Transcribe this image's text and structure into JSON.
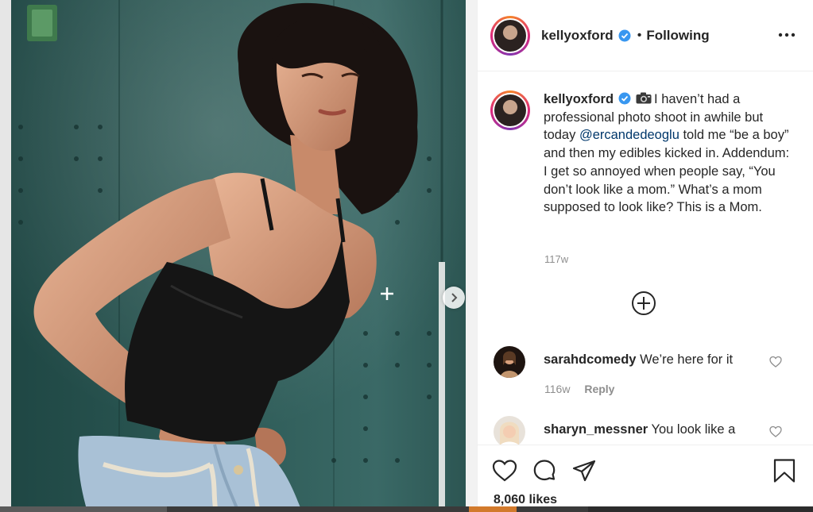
{
  "post": {
    "username": "kellyoxford",
    "separator": "•",
    "follow_state": "Following",
    "more_options_icon": "more-horizontal-icon",
    "caption": {
      "username": "kellyoxford",
      "text_before_mention": "I haven’t had a professional photo shoot in awhile but today ",
      "mention": "@ercandedeoglu",
      "text_after_mention": " told me “be a boy” and then my edibles kicked in. Addendum: I get so annoyed when people say, “You don’t look like a mom.” What’s a mom supposed to look like? This is a Mom."
    },
    "caption_time": "117w",
    "load_more_icon": "plus-circle-icon"
  },
  "comments": [
    {
      "username": "sarahdcomedy",
      "text": "We’re here for it",
      "time": "116w",
      "reply_label": "Reply"
    },
    {
      "username": "sharyn_messner",
      "text": "You look like a",
      "time": "",
      "reply_label": ""
    }
  ],
  "actions": {
    "like_icon": "heart-icon",
    "comment_icon": "comment-bubble-icon",
    "share_icon": "paper-plane-icon",
    "save_icon": "bookmark-icon",
    "likes": "8,060 likes"
  },
  "colors": {
    "text": "#262626",
    "secondary": "#8e8e8e",
    "mention": "#00376b",
    "verified": "#3897f0",
    "border": "#efefef"
  }
}
